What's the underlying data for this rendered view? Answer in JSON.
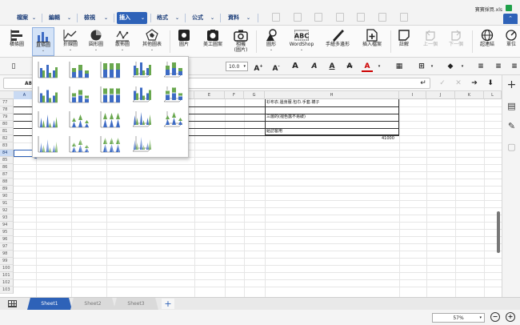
{
  "menu": {
    "items": [
      {
        "label": "檔案",
        "active": false
      },
      {
        "label": "編輯",
        "active": false
      },
      {
        "label": "檢視",
        "active": false
      },
      {
        "label": "插入",
        "active": true
      },
      {
        "label": "格式",
        "active": false
      },
      {
        "label": "公式",
        "active": false
      },
      {
        "label": "資料",
        "active": false
      }
    ],
    "filename": "寶寶採買.xls"
  },
  "ribbon": {
    "buttons": [
      {
        "label": "橫條圖",
        "icon": "bar-chart-horizontal-icon",
        "dropdown": false
      },
      {
        "label": "直條圖",
        "icon": "column-chart-icon",
        "dropdown": true,
        "selected": true
      },
      {
        "label": "折線圖",
        "icon": "line-chart-icon",
        "dropdown": true
      },
      {
        "label": "圓形圖",
        "icon": "pie-chart-icon",
        "dropdown": true
      },
      {
        "label": "散佈圖",
        "icon": "scatter-chart-icon",
        "dropdown": true
      },
      {
        "label": "其他圖表",
        "icon": "other-chart-icon",
        "dropdown": true
      },
      {
        "label": "圖片",
        "icon": "picture-icon",
        "dropdown": false
      },
      {
        "label": "美工圖案",
        "icon": "clipart-icon",
        "dropdown": false
      },
      {
        "label": "相機",
        "label2": "(圖片)",
        "icon": "camera-icon",
        "dropdown": false
      },
      {
        "label": "圖形",
        "icon": "shapes-icon",
        "dropdown": true
      },
      {
        "label": "WordShop",
        "icon": "wordshop-icon",
        "dropdown": true
      },
      {
        "label": "手繪多邊形",
        "icon": "freeform-icon",
        "dropdown": false
      },
      {
        "label": "插入檔案",
        "icon": "insert-file-icon",
        "dropdown": false
      },
      {
        "label": "註解",
        "icon": "comment-icon",
        "dropdown": false
      },
      {
        "label": "上一個",
        "icon": "previous-comment-icon",
        "dropdown": false,
        "disabled": true
      },
      {
        "label": "下一個",
        "icon": "next-comment-icon",
        "dropdown": false,
        "disabled": true
      },
      {
        "label": "超連結",
        "icon": "hyperlink-icon",
        "dropdown": false
      },
      {
        "label": "單位",
        "icon": "unit-icon",
        "dropdown": false
      }
    ]
  },
  "format": {
    "font_size": "10.0"
  },
  "namebox": {
    "value": "A84"
  },
  "columns": [
    "A",
    "B",
    "C",
    "D",
    "E",
    "F",
    "G",
    "H",
    "I",
    "J",
    "K",
    "L"
  ],
  "rows": [
    "77",
    "78",
    "79",
    "80",
    "81",
    "82",
    "83",
    "84",
    "85",
    "86",
    "87",
    "88",
    "89",
    "90",
    "91",
    "92",
    "93",
    "94",
    "95",
    "96",
    "97",
    "98",
    "99",
    "100",
    "101",
    "102",
    "103",
    "104",
    "105",
    "106",
    "107",
    "108",
    "109"
  ],
  "cells": {
    "h77": "衫布衣.邊身服.包巾.手套.襪子",
    "h79": "三層的(褪色露不易破)",
    "h81": "給訪客用",
    "i82": "41000"
  },
  "sheets": {
    "tabs": [
      "Sheet1",
      "Sheet2",
      "Sheet3"
    ],
    "active": "Sheet1"
  },
  "status": {
    "zoom": "57%"
  },
  "colors": {
    "accent": "#2e62b8",
    "menu_text": "#1e3f7a",
    "chart_green": "#6aa84f",
    "chart_blue": "#3d6bc4"
  }
}
